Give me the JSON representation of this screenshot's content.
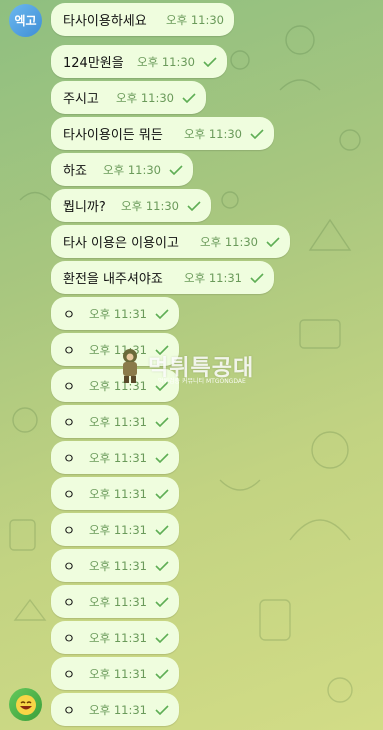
{
  "chat": {
    "sender_avatar_text": "엑고",
    "messages": [
      {
        "text": "타사이용하세요",
        "time": "오후 11:30",
        "read": false
      },
      {
        "text": "124만원을",
        "time": "오후 11:30",
        "read": true
      },
      {
        "text": "주시고",
        "time": "오후 11:30",
        "read": true
      },
      {
        "text": "타사이용이든 뭐든",
        "time": "오후 11:30",
        "read": true
      },
      {
        "text": "하죠",
        "time": "오후 11:30",
        "read": true
      },
      {
        "text": "뭡니까?",
        "time": "오후 11:30",
        "read": true
      },
      {
        "text": "타사 이용은 이용이고",
        "time": "오후 11:30",
        "read": true
      },
      {
        "text": "환전을 내주셔야죠",
        "time": "오후 11:31",
        "read": true
      },
      {
        "text": "ㅇ",
        "time": "오후 11:31",
        "read": true
      },
      {
        "text": "ㅇ",
        "time": "오후 11:31",
        "read": true
      },
      {
        "text": "ㅇ",
        "time": "오후 11:31",
        "read": true
      },
      {
        "text": "ㅇ",
        "time": "오후 11:31",
        "read": true
      },
      {
        "text": "ㅇ",
        "time": "오후 11:31",
        "read": true
      },
      {
        "text": "ㅇ",
        "time": "오후 11:31",
        "read": true
      },
      {
        "text": "ㅇ",
        "time": "오후 11:31",
        "read": true
      },
      {
        "text": "ㅇ",
        "time": "오후 11:31",
        "read": true
      },
      {
        "text": "ㅇ",
        "time": "오후 11:31",
        "read": true
      },
      {
        "text": "ㅇ",
        "time": "오후 11:31",
        "read": true
      },
      {
        "text": "ㅇ",
        "time": "오후 11:31",
        "read": true
      },
      {
        "text": "ㅇ",
        "time": "오후 11:31",
        "read": true
      }
    ]
  },
  "watermark": {
    "title": "먹튀특공대",
    "subtitle": "먹튀검증 커뮤니티 MTGONGDAE"
  },
  "colors": {
    "bubble": "#effdde",
    "time": "#6a9a5a",
    "check": "#5fae55"
  }
}
